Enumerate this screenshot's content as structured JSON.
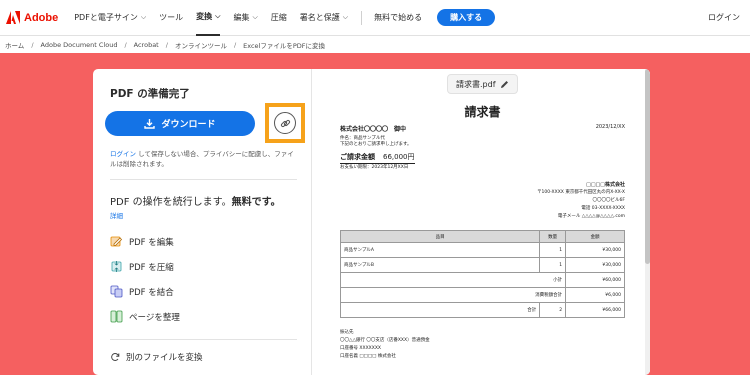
{
  "nav": {
    "brand": "Adobe",
    "brand_color": "#eb1000",
    "items": [
      {
        "label": "PDFと電子サイン",
        "dropdown": true
      },
      {
        "label": "ツール",
        "dropdown": false
      },
      {
        "label": "変換",
        "dropdown": true,
        "active": true
      },
      {
        "label": "編集",
        "dropdown": true
      },
      {
        "label": "圧縮",
        "dropdown": false
      },
      {
        "label": "署名と保護",
        "dropdown": true
      },
      {
        "label": "無料で始める",
        "dropdown": false
      }
    ],
    "buy_label": "購入する",
    "login_label": "ログイン",
    "accent": "#1473e6"
  },
  "breadcrumb": [
    "ホーム",
    "Adobe Document Cloud",
    "Acrobat",
    "オンラインツール",
    "ExcelファイルをPDFに変換"
  ],
  "panel": {
    "title": "PDF の準備完了",
    "download_label": "ダウンロード",
    "note_link": "ログイン",
    "note_text": " して保存しない場合、プライバシーに配慮し、ファイルは削除されます。",
    "continue_text": "PDF の操作を続行します。",
    "continue_bold": "無料です。",
    "detail_label": "詳細",
    "tools": [
      {
        "label": "PDF を編集",
        "icon": "edit-pdf-icon"
      },
      {
        "label": "PDF を圧縮",
        "icon": "compress-pdf-icon"
      },
      {
        "label": "PDF を結合",
        "icon": "combine-pdf-icon"
      },
      {
        "label": "ページを整理",
        "icon": "organize-pages-icon"
      }
    ],
    "convert_label": "別のファイルを変換",
    "background_color": "#f56060",
    "highlight_color": "#f6a21a"
  },
  "preview": {
    "filename": "請求書.pdf",
    "doc_title": "請求書",
    "recipient": "株式会社〇〇〇〇　御中",
    "date": "2023/12/XX",
    "subject_line1": "件名：商品サンプル代",
    "subject_line2": "下記のとおりご請求申し上げます。",
    "total_label": "ご請求金額",
    "total_amount": "66,000円",
    "deadline": "お支払い期限：2023年12月XX日",
    "issuer": {
      "company": "□□□□株式会社",
      "address1": "〒100-XXXX 東京都千代田区丸の内X-XX-X",
      "address2": "〇〇〇〇ビル6F",
      "phone": "電話 03-XXXX-XXXX",
      "email": "電子メール △△△△@△△△△.com"
    },
    "table": {
      "headers": [
        "品目",
        "数量",
        "金額"
      ],
      "rows": [
        {
          "item": "商品サンプルA",
          "qty": "1",
          "amount": "¥30,000"
        },
        {
          "item": "商品サンプルB",
          "qty": "1",
          "amount": "¥30,000"
        }
      ],
      "subtotal_label": "小計",
      "subtotal": "¥60,000",
      "tax_label": "消費税額合計",
      "tax": "¥6,000",
      "sum_label": "合計",
      "sum_qty": "2",
      "sum": "¥66,000"
    },
    "bank": {
      "heading": "振込先",
      "line1": "〇〇△△銀行 〇〇支店（店番XXX）普通預金",
      "line2": "口座番号 XXXXXXX",
      "line3": "口座名義 □□□□ 株式会社"
    }
  }
}
